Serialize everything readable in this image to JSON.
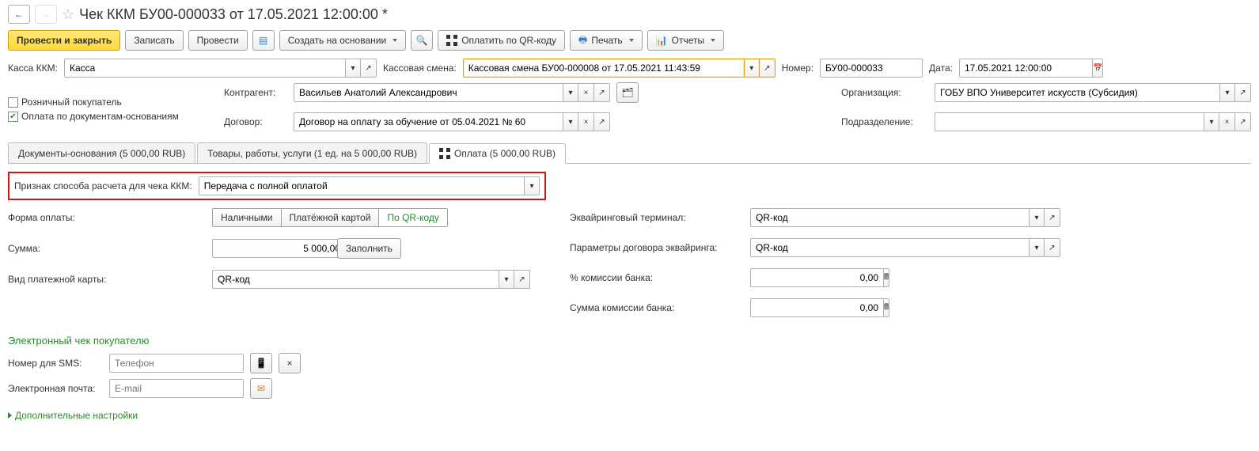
{
  "nav": {
    "back": "←",
    "forward": "→"
  },
  "title": "Чек ККМ БУ00-000033 от 17.05.2021 12:00:00 *",
  "toolbar": {
    "post_close": "Провести и закрыть",
    "save": "Записать",
    "post": "Провести",
    "create_based": "Создать на основании",
    "pay_qr": "Оплатить по QR-коду",
    "print": "Печать",
    "reports": "Отчеты"
  },
  "fields": {
    "kassa_label": "Касса ККМ:",
    "kassa_value": "Касса",
    "shift_label": "Кассовая смена:",
    "shift_value": "Кассовая смена БУ00-000008 от 17.05.2021 11:43:59",
    "number_label": "Номер:",
    "number_value": "БУ00-000033",
    "date_label": "Дата:",
    "date_value": "17.05.2021 12:00:00",
    "retail_buyer": "Розничный покупатель",
    "pay_by_docs": "Оплата по документам-основаниям",
    "contragent_label": "Контрагент:",
    "contragent_value": "Васильев Анатолий Александрович",
    "org_label": "Организация:",
    "org_value": "ГОБУ ВПО Университет искусств (Субсидия)",
    "contract_label": "Договор:",
    "contract_value": "Договор на оплату за обучение от 05.04.2021 № 60",
    "division_label": "Подразделение:",
    "division_value": ""
  },
  "tabs": {
    "t1": "Документы-основания (5 000,00 RUB)",
    "t2": "Товары, работы, услуги (1 ед. на 5 000,00 RUB)",
    "t3": "Оплата (5 000,00 RUB)"
  },
  "payment": {
    "calc_sign_label": "Признак способа расчета для чека ККМ:",
    "calc_sign_value": "Передача с полной оплатой",
    "form_label": "Форма оплаты:",
    "opt_cash": "Наличными",
    "opt_card": "Платёжной картой",
    "opt_qr": "По QR-коду",
    "sum_label": "Сумма:",
    "sum_value": "5 000,00",
    "fill": "Заполнить",
    "card_type_label": "Вид платежной карты:",
    "card_type_value": "QR-код",
    "terminal_label": "Эквайринговый терминал:",
    "terminal_value": "QR-код",
    "acq_params_label": "Параметры договора эквайринга:",
    "acq_params_value": "QR-код",
    "comm_pct_label": "% комиссии банка:",
    "comm_pct_value": "0,00",
    "comm_sum_label": "Сумма комиссии банка:",
    "comm_sum_value": "0,00"
  },
  "echeck": {
    "title": "Электронный чек покупателю",
    "sms_label": "Номер для SMS:",
    "sms_placeholder": "Телефон",
    "email_label": "Электронная почта:",
    "email_placeholder": "E-mail",
    "more": "Дополнительные настройки"
  }
}
